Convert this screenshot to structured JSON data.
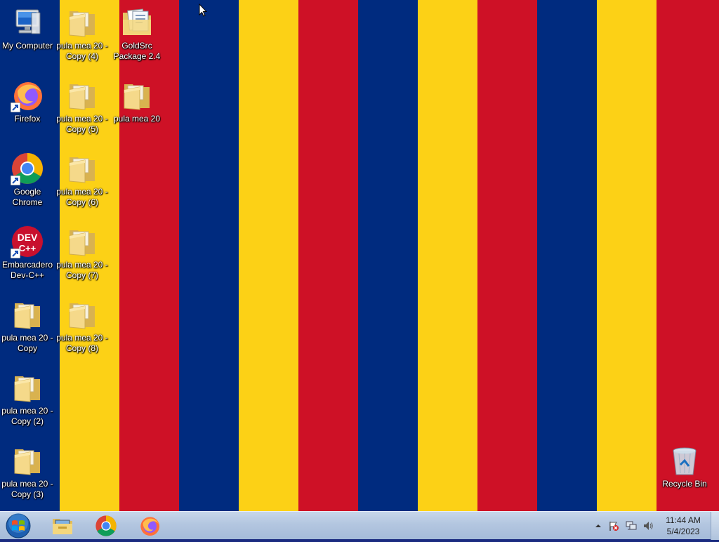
{
  "wallpaper": {
    "stripe_colors": [
      "#002b7f",
      "#fcd116",
      "#ce1126",
      "#002b7f",
      "#fcd116",
      "#ce1126",
      "#002b7f",
      "#fcd116",
      "#ce1126",
      "#002b7f",
      "#fcd116",
      "#ce1126"
    ]
  },
  "desktop_icons": [
    {
      "id": "my-computer",
      "label": "My Computer",
      "icon": "computer-icon"
    },
    {
      "id": "firefox",
      "label": "Firefox",
      "icon": "firefox-icon"
    },
    {
      "id": "google-chrome",
      "label": "Google Chrome",
      "icon": "chrome-icon"
    },
    {
      "id": "dev-cpp",
      "label": "Embarcadero Dev-C++",
      "icon": "devcpp-icon"
    },
    {
      "id": "folder-copy",
      "label": "pula mea 20 - Copy",
      "icon": "folder-icon"
    },
    {
      "id": "folder-copy-2",
      "label": "pula mea 20 - Copy (2)",
      "icon": "folder-icon"
    },
    {
      "id": "folder-copy-3",
      "label": "pula mea 20 - Copy (3)",
      "icon": "folder-icon"
    },
    {
      "id": "folder-copy-4",
      "label": "pula mea 20 - Copy (4)",
      "icon": "folder-icon"
    },
    {
      "id": "folder-copy-5",
      "label": "pula mea 20 - Copy (5)",
      "icon": "folder-icon"
    },
    {
      "id": "folder-copy-6",
      "label": "pula mea 20 - Copy (6)",
      "icon": "folder-icon"
    },
    {
      "id": "folder-copy-7",
      "label": "pula mea 20 - Copy (7)",
      "icon": "folder-icon"
    },
    {
      "id": "folder-copy-8",
      "label": "pula mea 20 - Copy (8)",
      "icon": "folder-icon"
    },
    {
      "id": "goldsrc-package",
      "label": "GoldSrc Package 2.4",
      "icon": "folder-with-files-icon"
    },
    {
      "id": "folder-main",
      "label": "pula mea 20",
      "icon": "folder-icon"
    },
    {
      "id": "recycle-bin",
      "label": "Recycle Bin",
      "icon": "recycle-bin-icon"
    }
  ],
  "taskbar": {
    "start": {
      "icon": "windows-start-orb-icon"
    },
    "pinned": [
      {
        "name": "file-explorer",
        "icon": "folder-library-icon"
      },
      {
        "name": "google-chrome",
        "icon": "chrome-icon"
      },
      {
        "name": "firefox",
        "icon": "firefox-icon"
      }
    ],
    "tray": {
      "icons": [
        "show-hidden-icons-chevron-icon",
        "action-center-flag-icon",
        "network-icon",
        "speaker-icon"
      ],
      "time": "11:44 AM",
      "date": "5/4/2023"
    }
  }
}
